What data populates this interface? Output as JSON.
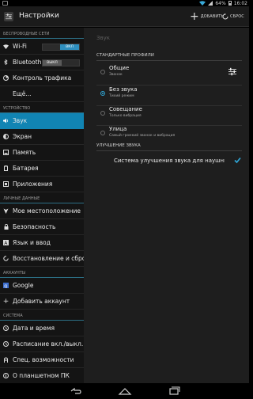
{
  "status_bar": {
    "battery": "64%",
    "time": "16:02"
  },
  "action_bar": {
    "title": "Настройки",
    "add_label": "ДОБАВИТЬ",
    "reset_label": "СБРОС"
  },
  "sidebar": {
    "sections": [
      {
        "header": "БЕСПРОВОДНЫЕ СЕТИ",
        "items": [
          {
            "label": "Wi-Fi",
            "icon": "wifi-icon",
            "toggle": "ВКЛ"
          },
          {
            "label": "Bluetooth",
            "icon": "bluetooth-icon",
            "toggle": "ВЫКЛ"
          },
          {
            "label": "Контроль трафика",
            "icon": "data-usage-icon"
          },
          {
            "label": "Ещё...",
            "icon": ""
          }
        ]
      },
      {
        "header": "УСТРОЙСТВО",
        "items": [
          {
            "label": "Звук",
            "icon": "sound-icon",
            "selected": true
          },
          {
            "label": "Экран",
            "icon": "display-icon"
          },
          {
            "label": "Память",
            "icon": "storage-icon"
          },
          {
            "label": "Батарея",
            "icon": "battery-icon"
          },
          {
            "label": "Приложения",
            "icon": "apps-icon"
          }
        ]
      },
      {
        "header": "ЛИЧНЫЕ ДАННЫЕ",
        "items": [
          {
            "label": "Мое местоположение",
            "icon": "location-icon"
          },
          {
            "label": "Безопасность",
            "icon": "lock-icon"
          },
          {
            "label": "Язык и ввод",
            "icon": "language-icon"
          },
          {
            "label": "Восстановление и сброс",
            "icon": "backup-icon"
          }
        ]
      },
      {
        "header": "АККАУНТЫ",
        "items": [
          {
            "label": "Google",
            "icon": "google-icon"
          },
          {
            "label": "Добавить аккаунт",
            "icon": "add-icon"
          }
        ]
      },
      {
        "header": "СИСТЕМА",
        "items": [
          {
            "label": "Дата и время",
            "icon": "clock-icon"
          },
          {
            "label": "Расписание вкл./выкл. п",
            "icon": "power-schedule-icon"
          },
          {
            "label": "Спец. возможности",
            "icon": "accessibility-icon"
          },
          {
            "label": "О планшетном ПК",
            "icon": "info-icon"
          }
        ]
      }
    ]
  },
  "detail": {
    "title": "Звук",
    "profiles_header": "СТАНДАРТНЫЕ ПРОФИЛИ",
    "profiles": [
      {
        "name": "Общие",
        "sub": "Звонок",
        "checked": false
      },
      {
        "name": "Без звука",
        "sub": "Тихий режим",
        "checked": true
      },
      {
        "name": "Совещание",
        "sub": "Только вибрация",
        "checked": false
      },
      {
        "name": "Улица",
        "sub": "Самый громкий звонок и вибрация",
        "checked": false
      }
    ],
    "enhancement_header": "УЛУЧШЕНИЕ ЗВУКА",
    "enhancement_label": "Система улучшения звука для наушни",
    "enhancement_checked": true
  },
  "colors": {
    "accent": "#1184b3",
    "check": "#2fa7d8"
  }
}
